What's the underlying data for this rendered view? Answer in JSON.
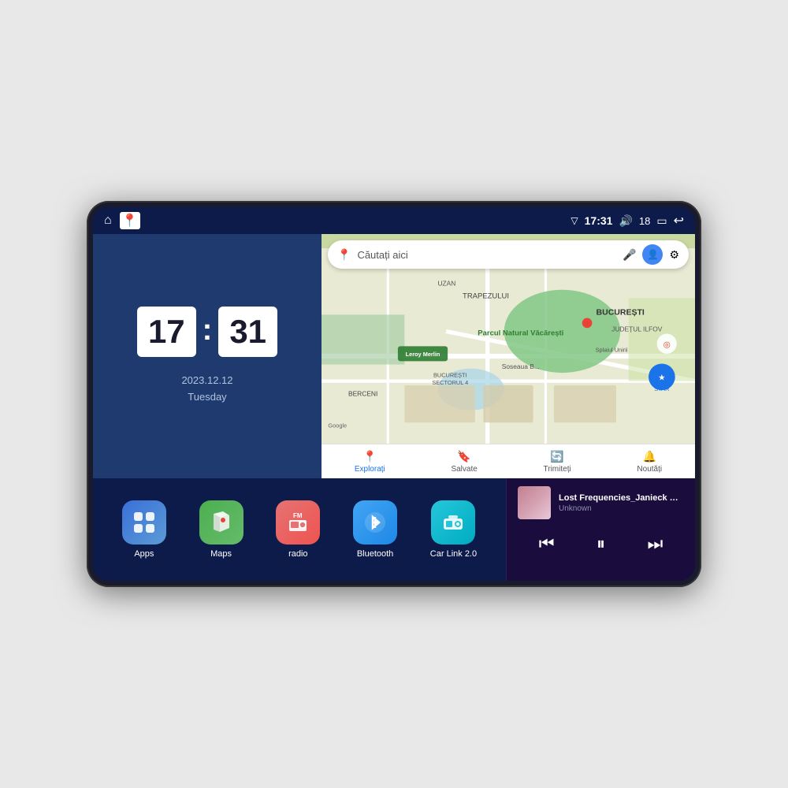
{
  "device": {
    "status_bar": {
      "signal_icon": "▽",
      "time": "17:31",
      "volume_icon": "🔊",
      "volume_level": "18",
      "battery_icon": "🔋",
      "back_icon": "↩"
    },
    "clock": {
      "hours": "17",
      "minutes": "31",
      "date": "2023.12.12",
      "day": "Tuesday"
    },
    "map": {
      "search_placeholder": "Căutați aici",
      "nav_items": [
        {
          "label": "Explorați",
          "icon": "📍"
        },
        {
          "label": "Salvate",
          "icon": "🔖"
        },
        {
          "label": "Trimiteți",
          "icon": "🔄"
        },
        {
          "label": "Noutăți",
          "icon": "🔔"
        }
      ]
    },
    "apps": [
      {
        "id": "apps",
        "label": "Apps",
        "icon_class": "icon-apps"
      },
      {
        "id": "maps",
        "label": "Maps",
        "icon_class": "icon-maps"
      },
      {
        "id": "radio",
        "label": "radio",
        "icon_class": "icon-radio"
      },
      {
        "id": "bluetooth",
        "label": "Bluetooth",
        "icon_class": "icon-bluetooth"
      },
      {
        "id": "carlink",
        "label": "Car Link 2.0",
        "icon_class": "icon-carlink"
      }
    ],
    "music": {
      "title": "Lost Frequencies_Janieck Devy-...",
      "artist": "Unknown",
      "prev_icon": "⏮",
      "play_icon": "⏸",
      "next_icon": "⏭"
    }
  }
}
